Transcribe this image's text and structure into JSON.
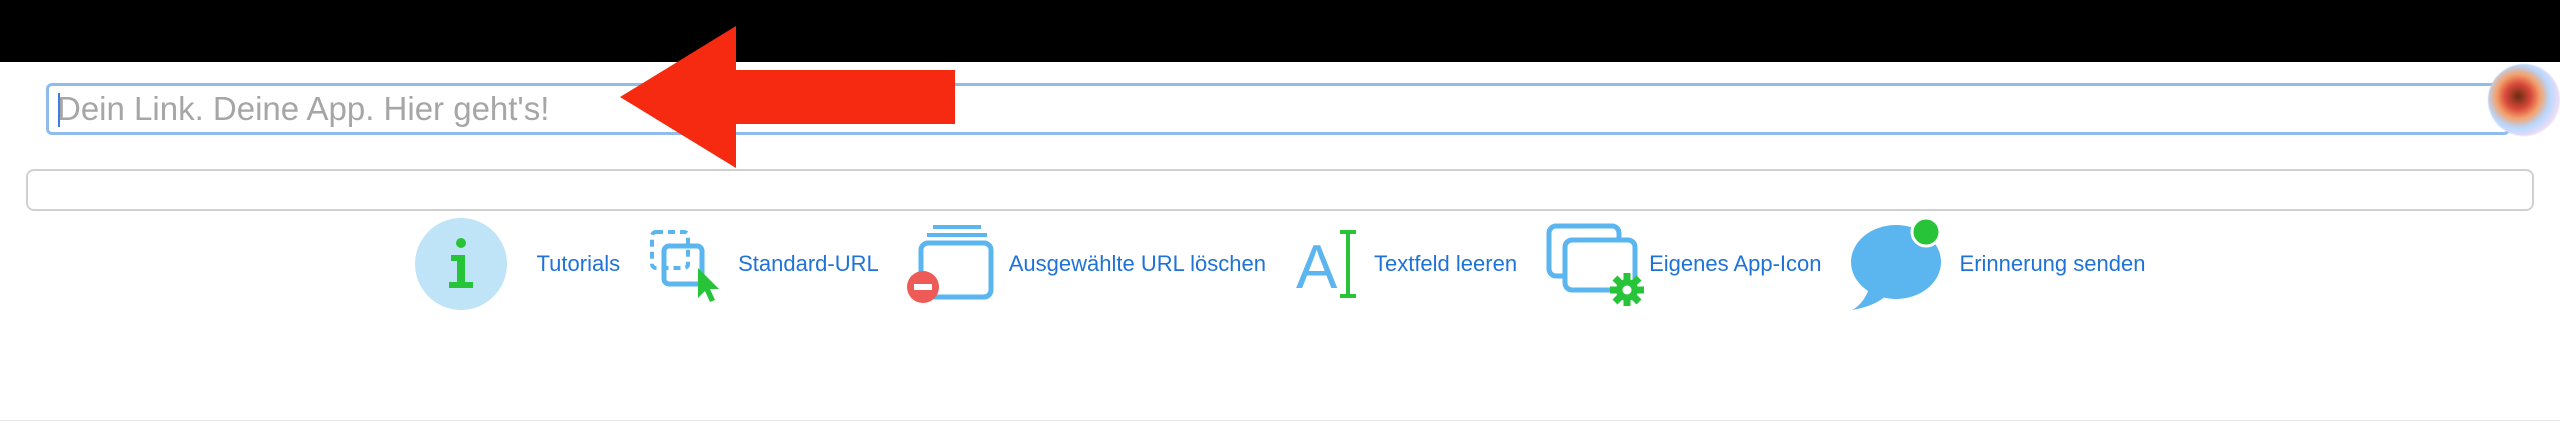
{
  "url_bar": {
    "placeholder": "Dein Link. Deine App. Hier geht's!",
    "value": ""
  },
  "secondary_bar": {
    "value": ""
  },
  "toolbar": {
    "items": [
      {
        "id": "tutorials",
        "label": "Tutorials",
        "icon": "info-icon"
      },
      {
        "id": "standard-url",
        "label": "Standard-URL",
        "icon": "select-cursor-icon"
      },
      {
        "id": "delete-url",
        "label": "Ausgewählte URL löschen",
        "icon": "stack-minus-icon"
      },
      {
        "id": "clear-text",
        "label": "Textfeld leeren",
        "icon": "text-cursor-icon"
      },
      {
        "id": "app-icon",
        "label": "Eigenes App-Icon",
        "icon": "windows-gear-icon"
      },
      {
        "id": "reminder",
        "label": "Erinnerung senden",
        "icon": "speech-bubble-icon"
      }
    ]
  },
  "annotation": {
    "icon": "arrow-left-icon",
    "color": "#f52a10"
  },
  "colors": {
    "accent_blue": "#1f72d8",
    "icon_blue": "#5bb5ee",
    "icon_green": "#27c43a",
    "danger_red": "#ee5a56",
    "url_border": "#8fbcec",
    "top_bar": "#000000"
  }
}
